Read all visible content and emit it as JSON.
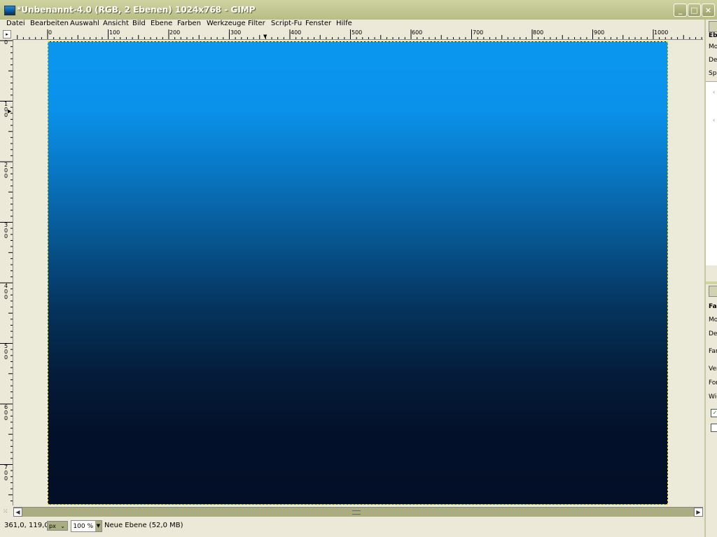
{
  "window": {
    "title": "*Unbenannt-4.0 (RGB, 2 Ebenen) 1024x768 - GIMP"
  },
  "menu": [
    "Datei",
    "Bearbeiten",
    "Auswahl",
    "Ansicht",
    "Bild",
    "Ebene",
    "Farben",
    "Werkzeuge",
    "Filter",
    "Script-Fu",
    "Fenster",
    "Hilfe"
  ],
  "ruler": {
    "h_labels": [
      "0",
      "100",
      "200",
      "300",
      "400",
      "500",
      "600",
      "700",
      "800",
      "900",
      "1000"
    ],
    "v_labels": [
      "0",
      "1\n0\n0",
      "2\n0\n0",
      "3\n0\n0",
      "4\n0\n0",
      "5\n0\n0",
      "6\n0\n0",
      "7\n0\n0"
    ]
  },
  "image": {
    "gradient_top": "#0a97f0",
    "gradient_bottom": "#030f27",
    "selection_color": "#ffd400"
  },
  "status": {
    "coords": "361,0, 119,0",
    "unit": "px",
    "zoom": "100 %",
    "layer": "Neue Ebene (52,0 MB)"
  },
  "panel": {
    "top_labels": [
      "Ebe",
      "Mo",
      "De",
      "Spe"
    ],
    "bottom_labels": [
      "Far",
      "Mo",
      "De",
      "Far",
      "Ver",
      "For",
      "Wie"
    ]
  }
}
